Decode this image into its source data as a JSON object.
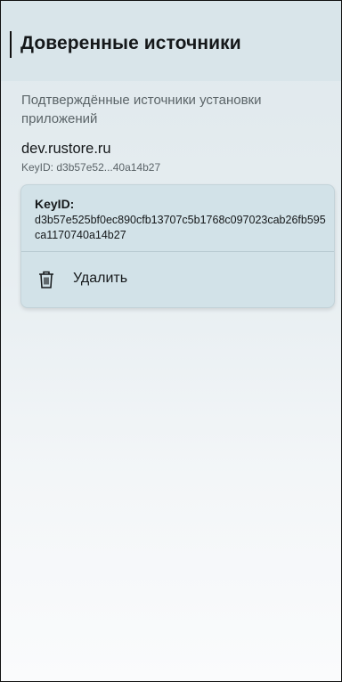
{
  "header": {
    "title": "Доверенные источники"
  },
  "content": {
    "subtitle": "Подтверждённые источники установки приложений",
    "source": {
      "name": "dev.rustore.ru",
      "key_short": "KeyID: d3b57e52...40a14b27"
    }
  },
  "popup": {
    "key_label": "KeyID:",
    "key_value": "d3b57e525bf0ec890cfb13707c5b1768c097023cab26fb595ca1170740a14b27",
    "delete_label": "Удалить",
    "delete_icon": "trash-icon"
  }
}
